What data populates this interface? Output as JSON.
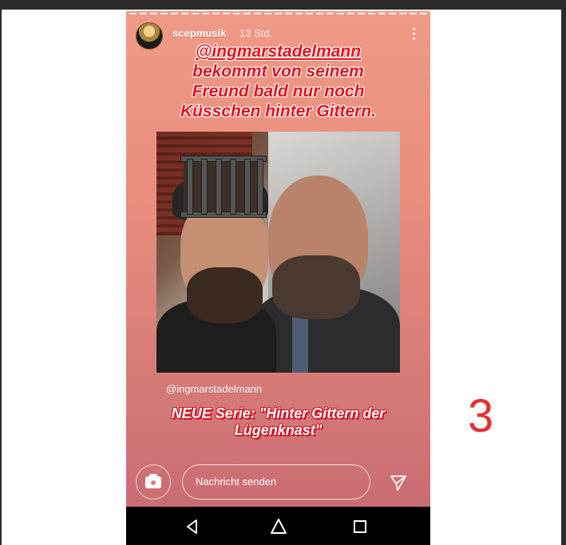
{
  "story": {
    "username": "scepmusik",
    "age": "13 Std.",
    "caption_mention": "@ingmarstadelmann",
    "caption_lines": [
      "bekommt von seinem",
      "Freund bald nur noch",
      "Küsschen hinter Gittern."
    ],
    "credit": "@ingmarstadelmann",
    "subtitle_line1": "NEUE Serie: \"Hinter Gittern der",
    "subtitle_line2": "Lügenknast\""
  },
  "reply": {
    "placeholder": "Nachricht senden"
  },
  "annotation": {
    "number": "3"
  },
  "icons": {
    "camera": "camera-icon",
    "send": "send-icon",
    "more": "more-vertical-icon",
    "back": "nav-back-icon",
    "home": "nav-home-icon",
    "recents": "nav-recents-icon"
  },
  "colors": {
    "caption_red": "#e0121e",
    "story_bg_top": "#ef9a86",
    "story_bg_bottom": "#c66872",
    "annotation_red": "#e53030"
  }
}
